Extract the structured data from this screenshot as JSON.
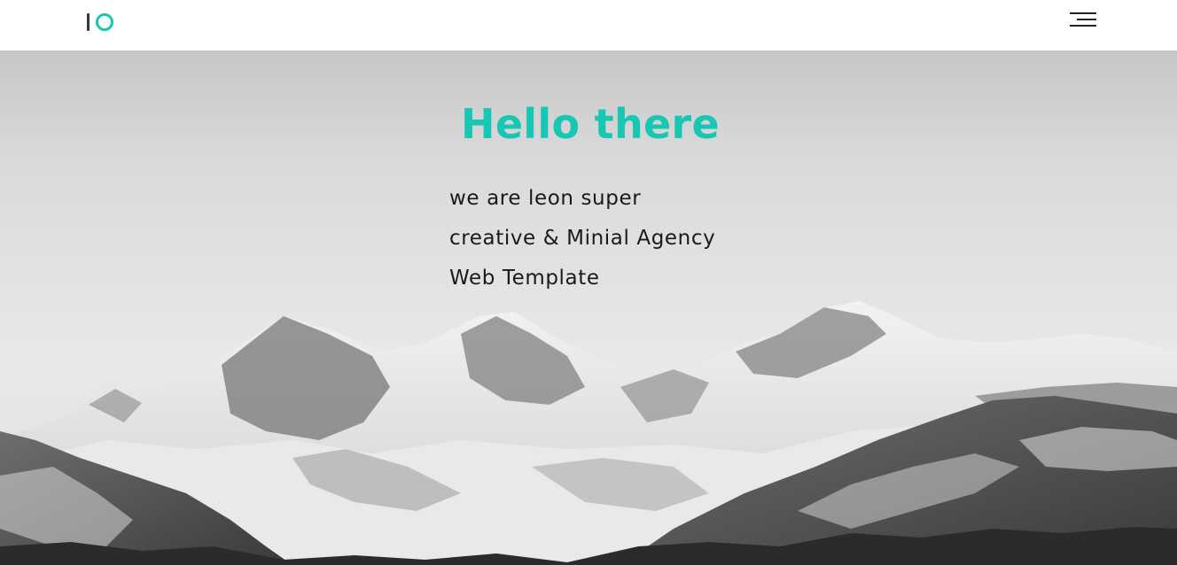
{
  "header": {
    "logo": {
      "name": "IO",
      "accent_color": "#17c7b4"
    },
    "menu_icon": "hamburger-menu-icon"
  },
  "hero": {
    "title": "Hello there",
    "lines": [
      "we are leon super",
      "creative & Minial Agency",
      "Web Template"
    ],
    "background_image": "snowy-mountains-grayscale"
  },
  "colors": {
    "accent": "#17c7b4",
    "text": "#1a1a1a",
    "nav_bg": "#ffffff"
  }
}
